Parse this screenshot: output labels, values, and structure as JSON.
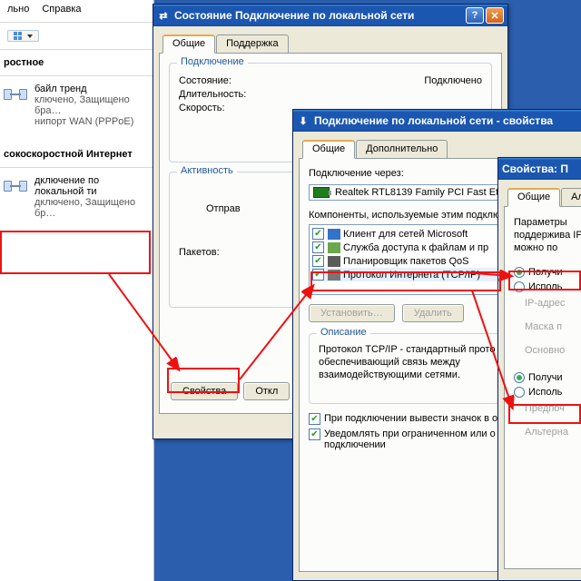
{
  "left": {
    "menu1": "льно",
    "menu2": "Справка",
    "section1": "ростное",
    "item1_t": "байл тренд",
    "item1_s1": "ключено, Защищено бра…",
    "item1_s2": "нипорт WAN (PPPoE)",
    "section2": "сокоскоростной Интернет",
    "conn_t": "дключение по локальной ти",
    "conn_s": "дключено, Защищено бр…"
  },
  "win1": {
    "title": "Состояние Подключение по локальной сети",
    "tab_general": "Общие",
    "tab_support": "Поддержка",
    "grp_conn": "Подключение",
    "lab_state": "Состояние:",
    "val_state": "Подключено",
    "lab_duration": "Длительность:",
    "lab_speed": "Скорость:",
    "grp_activity": "Активность",
    "lab_sent": "Отправ",
    "lab_packets": "Пакетов:",
    "btn_props": "Свойства",
    "btn_close": "Откл"
  },
  "win2": {
    "title": "Подключение по локальной сети - свойства",
    "tab_general": "Общие",
    "tab_adv": "Дополнительно",
    "connect_via": "Подключение через:",
    "adapter": "Realtek RTL8139 Family PCI Fast Et",
    "components_label": "Компоненты, используемые этим подклю",
    "c1": "Клиент для сетей Microsoft",
    "c2": "Служба доступа к файлам и пр",
    "c3": "Планировщик пакетов QoS",
    "c4": "Протокол Интернета (TCP/IP)",
    "btn_install": "Установить…",
    "btn_remove": "Удалить",
    "grp_desc": "Описание",
    "desc": "Протокол TCP/IP - стандартный прото сетей, обеспечивающий связь между взаимодействующими сетями.",
    "chk_tray": "При подключении вывести значок в о",
    "chk_notify": "Уведомлять при ограниченном или о подключении"
  },
  "win3": {
    "title": "Свойства: П",
    "tab_general": "Общие",
    "tab_alt": "Аль",
    "intro": "Параметры поддержива IP можно по",
    "r1": "Получи",
    "r2": "Исполь",
    "ip": "IP-адрес",
    "mask": "Маска п",
    "gw": "Основно",
    "r3": "Получи",
    "r4": "Исполь",
    "pref": "Предпоч",
    "alt": "Альтерна"
  }
}
